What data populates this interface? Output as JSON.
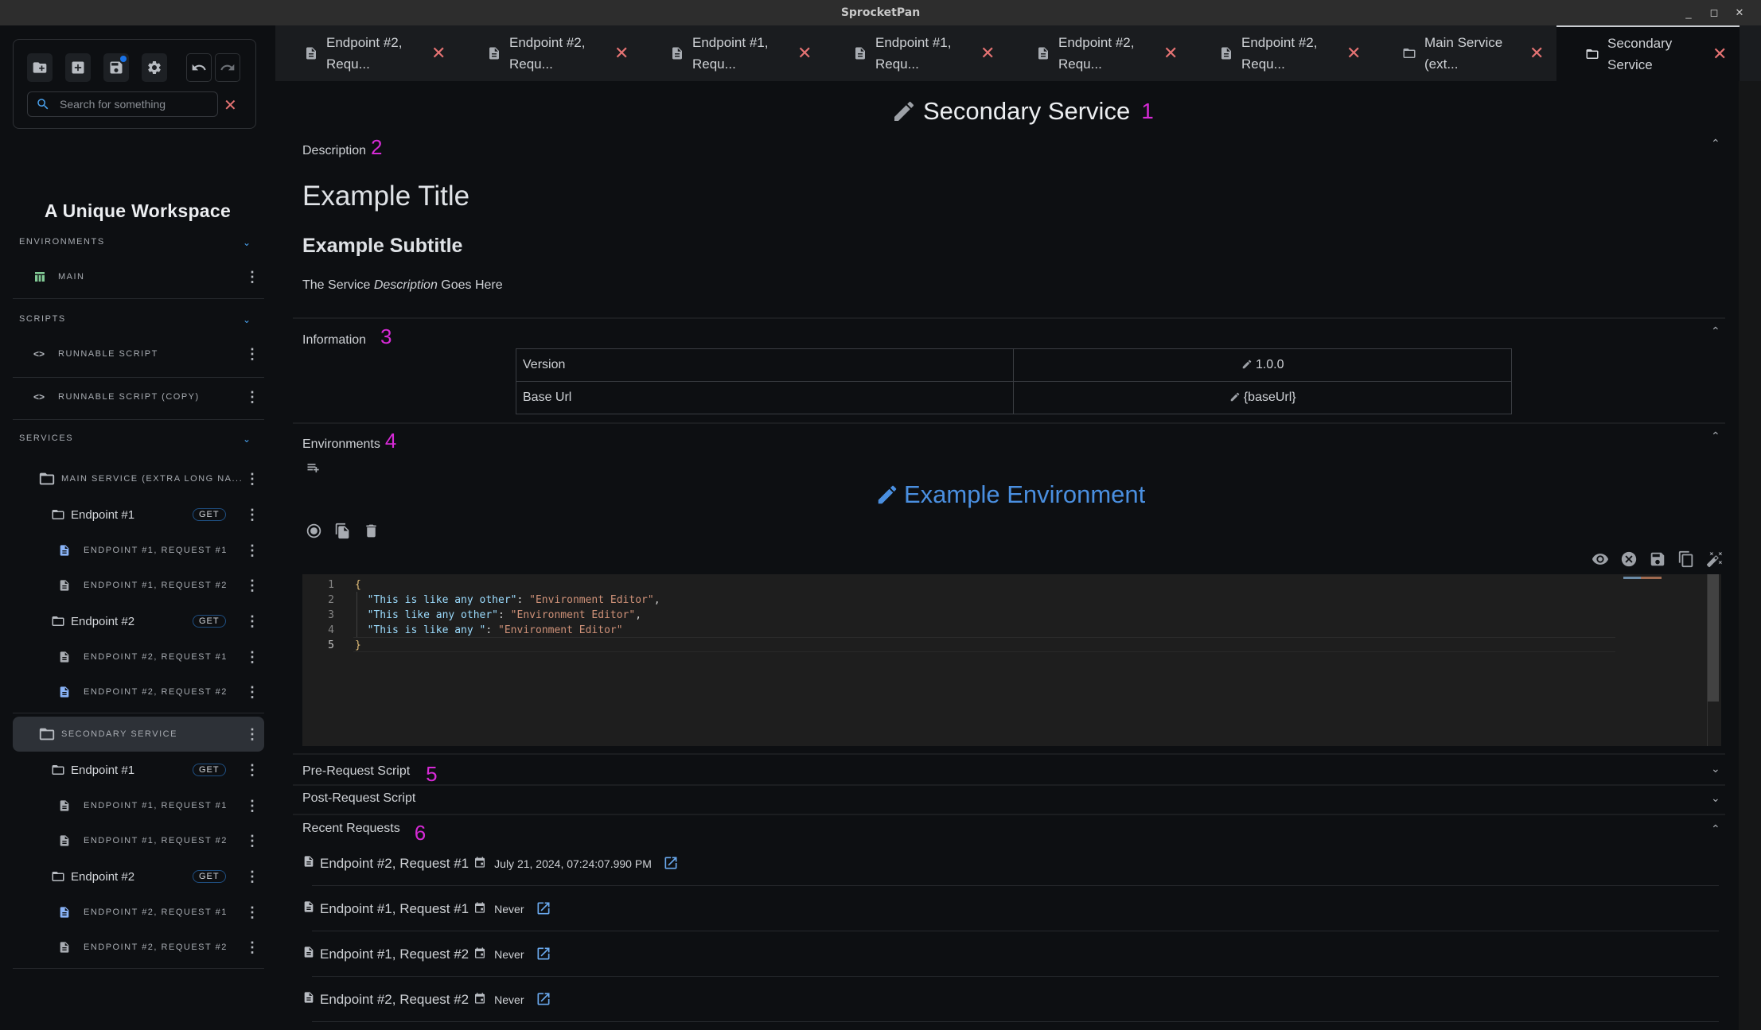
{
  "window": {
    "title": "SprocketPan",
    "controls": {
      "minimize": "_",
      "maximize": "◻",
      "close": "✕"
    }
  },
  "toolbar": {
    "buttons": [
      "new-folder-icon",
      "add-box-icon",
      "save-icon",
      "gear-icon",
      "undo-icon",
      "redo-icon"
    ],
    "save_unsaved_indicator_color": "#1a73e8",
    "search_placeholder": "Search for something",
    "search_value": "",
    "clear_label": "✕"
  },
  "sidebar": {
    "workspace_title": "A Unique Workspace",
    "sections": {
      "environments": {
        "label": "ENVIRONMENTS",
        "items": [
          {
            "label": "MAIN",
            "icon": "table-icon",
            "icon_color": "#81c995"
          }
        ]
      },
      "scripts": {
        "label": "SCRIPTS",
        "items": [
          {
            "label": "RUNNABLE SCRIPT",
            "icon": "code-icon"
          },
          {
            "label": "RUNNABLE SCRIPT (COPY)",
            "icon": "code-icon"
          }
        ]
      },
      "services": {
        "label": "SERVICES",
        "items": [
          {
            "label": "MAIN SERVICE (EXTRA LONG NA...",
            "selected": false,
            "endpoints": [
              {
                "label": "Endpoint #1",
                "method": "GET",
                "requests": [
                  {
                    "label": "ENDPOINT #1, REQUEST #1",
                    "highlighted": true
                  },
                  {
                    "label": "ENDPOINT #1, REQUEST #2",
                    "highlighted": false
                  }
                ]
              },
              {
                "label": "Endpoint #2",
                "method": "GET",
                "requests": [
                  {
                    "label": "ENDPOINT #2, REQUEST #1",
                    "highlighted": false
                  },
                  {
                    "label": "ENDPOINT #2, REQUEST #2",
                    "highlighted": true
                  }
                ]
              }
            ]
          },
          {
            "label": "SECONDARY SERVICE",
            "selected": true,
            "endpoints": [
              {
                "label": "Endpoint #1",
                "method": "GET",
                "requests": [
                  {
                    "label": "ENDPOINT #1, REQUEST #1",
                    "highlighted": false
                  },
                  {
                    "label": "ENDPOINT #1, REQUEST #2",
                    "highlighted": false
                  }
                ]
              },
              {
                "label": "Endpoint #2",
                "method": "GET",
                "requests": [
                  {
                    "label": "ENDPOINT #2, REQUEST #1",
                    "highlighted": true
                  },
                  {
                    "label": "ENDPOINT #2, REQUEST #2",
                    "highlighted": false
                  }
                ]
              }
            ]
          }
        ]
      }
    }
  },
  "tabs": [
    {
      "label": "Endpoint #2, Requ...",
      "icon": "document-icon",
      "active": false
    },
    {
      "label": "Endpoint #2, Requ...",
      "icon": "document-icon",
      "active": false
    },
    {
      "label": "Endpoint #1, Requ...",
      "icon": "document-icon",
      "active": false
    },
    {
      "label": "Endpoint #1, Requ...",
      "icon": "document-icon",
      "active": false
    },
    {
      "label": "Endpoint #2, Requ...",
      "icon": "document-icon",
      "active": false
    },
    {
      "label": "Endpoint #2, Requ...",
      "icon": "document-icon",
      "active": false
    },
    {
      "label": "Main Service (ext...",
      "icon": "folder-icon",
      "active": false
    },
    {
      "label": "Secondary Service",
      "icon": "folder-icon",
      "active": true
    }
  ],
  "tab_close_label": "✕",
  "main": {
    "title": "Secondary Service",
    "annotations": [
      "1",
      "2",
      "3",
      "4",
      "5",
      "6"
    ],
    "annotation_color": "#d62ad6",
    "description": {
      "header": "Description",
      "h1": "Example Title",
      "h2": "Example Subtitle",
      "p_before": "The Service ",
      "p_em": "Description",
      "p_after": " Goes Here"
    },
    "information": {
      "header": "Information",
      "rows": [
        {
          "key": "Version",
          "value": "1.0.0"
        },
        {
          "key": "Base Url",
          "value": "{baseUrl}"
        }
      ]
    },
    "environments": {
      "header": "Environments",
      "env_title": "Example Environment",
      "editor_lines": [
        {
          "n": "1",
          "parts": [
            {
              "t": "{",
              "c": "brace"
            }
          ]
        },
        {
          "n": "2",
          "parts": [
            {
              "t": "  \"This is like any other\"",
              "c": "key"
            },
            {
              "t": ": ",
              "c": "punc"
            },
            {
              "t": "\"Environment Editor\"",
              "c": "str"
            },
            {
              "t": ",",
              "c": "punc"
            }
          ]
        },
        {
          "n": "3",
          "parts": [
            {
              "t": "  \"This like any other\"",
              "c": "key"
            },
            {
              "t": ": ",
              "c": "punc"
            },
            {
              "t": "\"Environment Editor\"",
              "c": "str"
            },
            {
              "t": ",",
              "c": "punc"
            }
          ]
        },
        {
          "n": "4",
          "parts": [
            {
              "t": "  \"This is like any \"",
              "c": "key"
            },
            {
              "t": ": ",
              "c": "punc"
            },
            {
              "t": "\"Environment Editor\"",
              "c": "str"
            }
          ]
        },
        {
          "n": "5",
          "parts": [
            {
              "t": "}",
              "c": "brace"
            }
          ]
        }
      ],
      "current_line": "5"
    },
    "pre_request": {
      "header": "Pre-Request Script"
    },
    "post_request": {
      "header": "Post-Request Script"
    },
    "recent": {
      "header": "Recent Requests",
      "rows": [
        {
          "name": "Endpoint #2, Request #1",
          "time": "July 21, 2024, 07:24:07.990 PM"
        },
        {
          "name": "Endpoint #1, Request #1",
          "time": "Never"
        },
        {
          "name": "Endpoint #1, Request #2",
          "time": "Never"
        },
        {
          "name": "Endpoint #2, Request #2",
          "time": "Never"
        }
      ]
    }
  }
}
